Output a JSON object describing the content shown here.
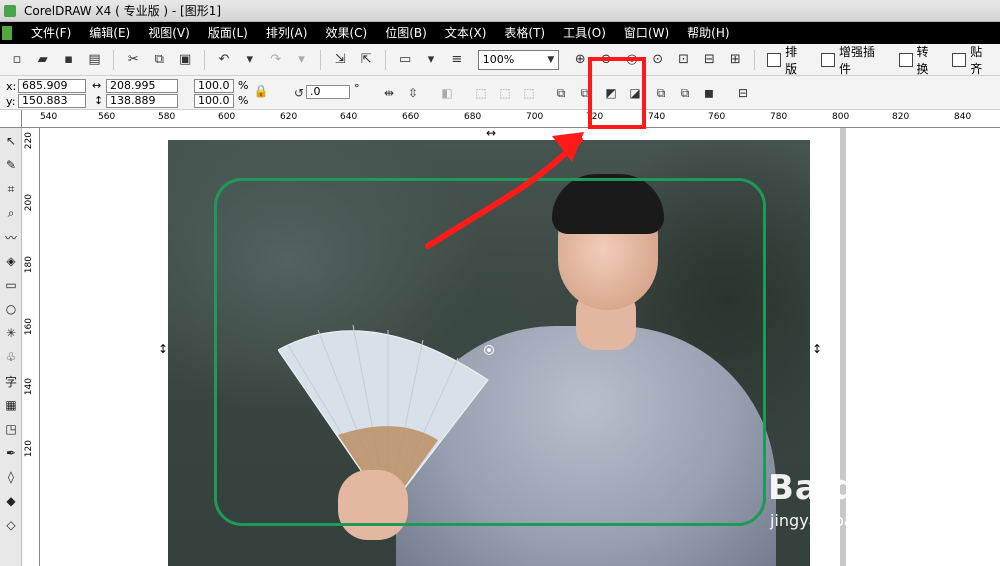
{
  "window": {
    "title": "CorelDRAW X4 ( 专业版 ) - [图形1]"
  },
  "menu": [
    "文件(F)",
    "编辑(E)",
    "视图(V)",
    "版面(L)",
    "排列(A)",
    "效果(C)",
    "位图(B)",
    "文本(X)",
    "表格(T)",
    "工具(O)",
    "窗口(W)",
    "帮助(H)"
  ],
  "toolbar": {
    "zoom": "100%",
    "buttons": [
      "排版",
      "增强插件",
      "转换",
      "贴齐"
    ]
  },
  "properties": {
    "x_label": "x:",
    "x_value": "685.909 mm",
    "y_label": "y:",
    "y_value": "150.883 mm",
    "w_value": "208.995 mm",
    "h_value": "138.889 mm",
    "scale_x": "100.0",
    "scale_y": "100.0",
    "percent": "%",
    "rotation": ".0",
    "degree": "°"
  },
  "ruler": {
    "horizontal": [
      "540",
      "560",
      "580",
      "600",
      "620",
      "640",
      "660",
      "680",
      "700",
      "720",
      "740",
      "760",
      "780",
      "800",
      "820",
      "840"
    ],
    "vertical": [
      "220",
      "200",
      "180",
      "160",
      "140",
      "120"
    ]
  },
  "toolbox": [
    "pick-tool",
    "shape-tool",
    "crop-tool",
    "zoom-tool",
    "freehand-tool",
    "smart-fill-tool",
    "rectangle-tool",
    "ellipse-tool",
    "polygon-tool",
    "basic-shapes-tool",
    "text-tool",
    "table-tool",
    "interactive-tool",
    "eyedropper-tool",
    "outline-tool",
    "fill-tool",
    "interactive-fill-tool"
  ],
  "text_tool_glyph": "字",
  "watermark": {
    "brand": "Baidu经验",
    "url": "jingyan.baidu.com"
  },
  "colors": {
    "menubar": "#000000",
    "frame": "#1e9a58",
    "annotation": "#ff1a1a"
  }
}
